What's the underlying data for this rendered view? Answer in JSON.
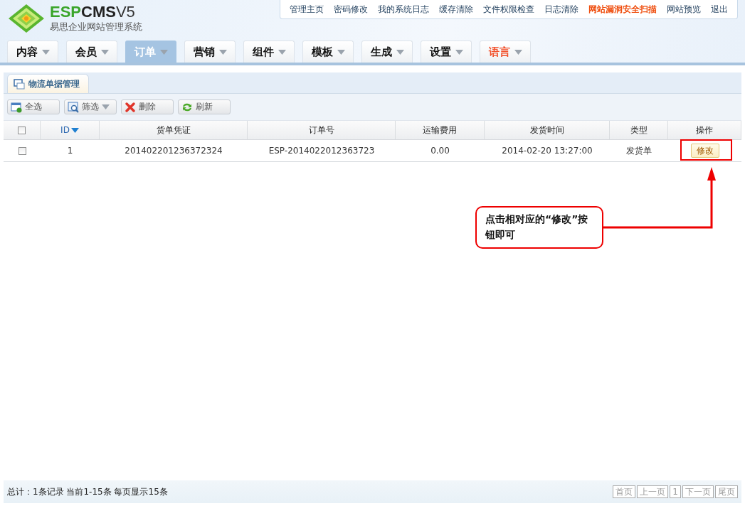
{
  "logo": {
    "wordmark": [
      "ESP",
      "CMS"
    ],
    "version": "V5",
    "subtitle": "易思企业网站管理系统"
  },
  "top_links": [
    {
      "label": "管理主页",
      "highlight": false
    },
    {
      "label": "密码修改",
      "highlight": false
    },
    {
      "label": "我的系统日志",
      "highlight": false
    },
    {
      "label": "缓存清除",
      "highlight": false
    },
    {
      "label": "文件权限检查",
      "highlight": false
    },
    {
      "label": "日志清除",
      "highlight": false
    },
    {
      "label": "网站漏洞安全扫描",
      "highlight": true
    },
    {
      "label": "网站预览",
      "highlight": false
    },
    {
      "label": "退出",
      "highlight": false
    }
  ],
  "nav_tabs": [
    {
      "label": "内容",
      "selected": false,
      "highlight": false
    },
    {
      "label": "会员",
      "selected": false,
      "highlight": false
    },
    {
      "label": "订单",
      "selected": true,
      "highlight": false
    },
    {
      "label": "营销",
      "selected": false,
      "highlight": false
    },
    {
      "label": "组件",
      "selected": false,
      "highlight": false
    },
    {
      "label": "模板",
      "selected": false,
      "highlight": false
    },
    {
      "label": "生成",
      "selected": false,
      "highlight": false
    },
    {
      "label": "设置",
      "selected": false,
      "highlight": false
    },
    {
      "label": "语言",
      "selected": false,
      "highlight": true
    }
  ],
  "panel_tab": "物流单据管理",
  "toolbar": [
    {
      "label": "全选",
      "kind": "selectall",
      "dropdown": false
    },
    {
      "label": "筛选",
      "kind": "filter",
      "dropdown": true
    },
    {
      "label": "删除",
      "kind": "delete",
      "dropdown": false
    },
    {
      "label": "刷新",
      "kind": "refresh",
      "dropdown": false
    }
  ],
  "table": {
    "select_all_checked": false,
    "columns": [
      {
        "label": "ID",
        "sorted": true
      },
      {
        "label": "货单凭证",
        "sorted": false
      },
      {
        "label": "订单号",
        "sorted": false
      },
      {
        "label": "运输费用",
        "sorted": false
      },
      {
        "label": "发货时间",
        "sorted": false
      },
      {
        "label": "类型",
        "sorted": false
      },
      {
        "label": "操作",
        "sorted": false
      }
    ],
    "rows": [
      {
        "checked": false,
        "cells": [
          "1",
          "201402201236372324",
          "ESP-2014022012363723",
          "0.00",
          "2014-02-20 13:27:00",
          "发货单"
        ],
        "action": "修改"
      }
    ]
  },
  "annotation": {
    "text": "点击相对应的“修改”按钮即可"
  },
  "footer": {
    "summary": "总计：1条记录 当前1-15条 每页显示15条",
    "pager": [
      "首页",
      "上一页",
      "1",
      "下一页",
      "尾页"
    ]
  }
}
